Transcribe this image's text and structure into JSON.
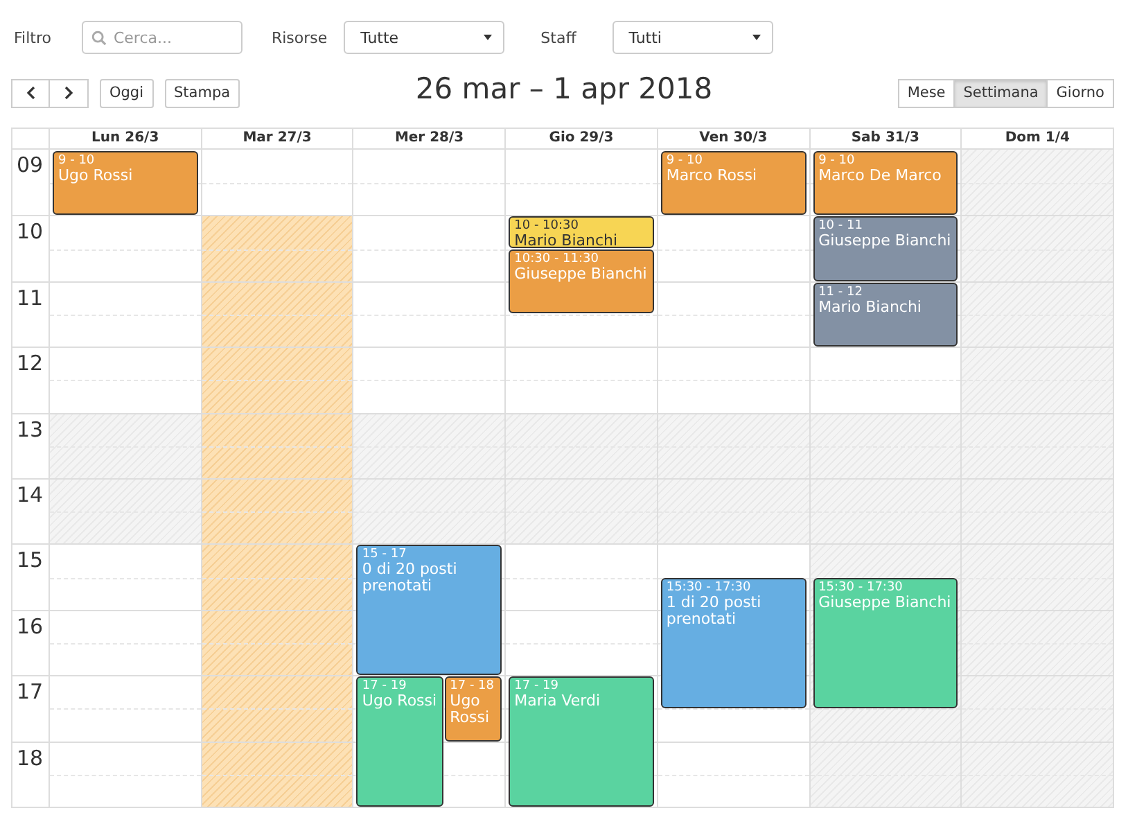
{
  "filters": {
    "filter_label": "Filtro",
    "search": {
      "placeholder": "Cerca..."
    },
    "resources_label": "Risorse",
    "resources": {
      "value": "Tutte"
    },
    "staff_label": "Staff",
    "staff": {
      "value": "Tutti"
    }
  },
  "toolbar": {
    "today": "Oggi",
    "print": "Stampa",
    "title": "26 mar – 1 apr 2018",
    "views": [
      {
        "label": "Mese",
        "selected": false
      },
      {
        "label": "Settimana",
        "selected": true
      },
      {
        "label": "Giorno",
        "selected": false
      }
    ]
  },
  "days": [
    {
      "label": "Lun 26/3",
      "events": [
        {
          "time": "9 - 10",
          "title": "Ugo Rossi",
          "color": "#eb9e45"
        }
      ]
    },
    {
      "label": "Mar 27/3"
    },
    {
      "label": "Mer 28/3",
      "events": [
        {
          "time": "15 - 17",
          "title": "0 di 20 posti prenotati",
          "color": "#66aee2"
        },
        {
          "time": "17 - 19",
          "title": "Ugo Rossi",
          "color": "#5ad3a0"
        },
        {
          "time": "17 - 18",
          "title": "Ugo Rossi",
          "color": "#eb9e45"
        }
      ]
    },
    {
      "label": "Gio 29/3",
      "events": [
        {
          "time": "10 - 10:30",
          "title": "Mario Bianchi",
          "color": "#f7d554"
        },
        {
          "time": "10:30 - 11:30",
          "title": "Giuseppe Bianchi",
          "color": "#eb9e45"
        },
        {
          "time": "17 - 19",
          "title": "Maria Verdi",
          "color": "#5ad3a0"
        }
      ]
    },
    {
      "label": "Ven 30/3",
      "events": [
        {
          "time": "9 - 10",
          "title": "Marco Rossi",
          "color": "#eb9e45"
        },
        {
          "time": "15:30 - 17:30",
          "title": "1 di 20 posti prenotati",
          "color": "#66aee2"
        }
      ]
    },
    {
      "label": "Sab 31/3",
      "events": [
        {
          "time": "9 - 10",
          "title": "Marco De Marco",
          "color": "#eb9e45"
        },
        {
          "time": "10 - 11",
          "title": "Giuseppe Bianchi",
          "color": "#8391a4"
        },
        {
          "time": "11 - 12",
          "title": "Mario Bianchi",
          "color": "#8391a4"
        },
        {
          "time": "15:30 - 17:30",
          "title": "Giuseppe Bianchi",
          "color": "#5ad3a0"
        }
      ]
    },
    {
      "label": "Dom 1/4"
    }
  ],
  "hours": [
    {
      "label": "09",
      "cells": [
        {
          "kind": "open"
        },
        {
          "kind": "open"
        },
        {
          "kind": "open"
        },
        {
          "kind": "open"
        },
        {
          "kind": "open"
        },
        {
          "kind": "open"
        },
        {
          "kind": "closed"
        }
      ]
    },
    {
      "label": "10",
      "cells": [
        {
          "kind": "open"
        },
        {
          "kind": "blocked"
        },
        {
          "kind": "open"
        },
        {
          "kind": "open"
        },
        {
          "kind": "open"
        },
        {
          "kind": "open"
        },
        {
          "kind": "closed"
        }
      ]
    },
    {
      "label": "11",
      "cells": [
        {
          "kind": "open"
        },
        {
          "kind": "blocked"
        },
        {
          "kind": "open"
        },
        {
          "kind": "open"
        },
        {
          "kind": "open"
        },
        {
          "kind": "open"
        },
        {
          "kind": "closed"
        }
      ]
    },
    {
      "label": "12",
      "cells": [
        {
          "kind": "open"
        },
        {
          "kind": "blocked"
        },
        {
          "kind": "open"
        },
        {
          "kind": "open"
        },
        {
          "kind": "open"
        },
        {
          "kind": "open"
        },
        {
          "kind": "closed"
        }
      ]
    },
    {
      "label": "13",
      "cells": [
        {
          "kind": "closed"
        },
        {
          "kind": "blocked"
        },
        {
          "kind": "closed"
        },
        {
          "kind": "closed"
        },
        {
          "kind": "closed"
        },
        {
          "kind": "closed"
        },
        {
          "kind": "closed"
        }
      ]
    },
    {
      "label": "14",
      "cells": [
        {
          "kind": "closed"
        },
        {
          "kind": "blocked"
        },
        {
          "kind": "closed"
        },
        {
          "kind": "closed"
        },
        {
          "kind": "closed"
        },
        {
          "kind": "closed"
        },
        {
          "kind": "closed"
        }
      ]
    },
    {
      "label": "15",
      "cells": [
        {
          "kind": "open"
        },
        {
          "kind": "blocked"
        },
        {
          "kind": "open"
        },
        {
          "kind": "open"
        },
        {
          "kind": "open"
        },
        {
          "kind": "closed"
        },
        {
          "kind": "closed"
        }
      ]
    },
    {
      "label": "16",
      "cells": [
        {
          "kind": "open"
        },
        {
          "kind": "blocked"
        },
        {
          "kind": "open"
        },
        {
          "kind": "open"
        },
        {
          "kind": "open"
        },
        {
          "kind": "closed"
        },
        {
          "kind": "closed"
        }
      ]
    },
    {
      "label": "17",
      "cells": [
        {
          "kind": "open"
        },
        {
          "kind": "blocked"
        },
        {
          "kind": "open"
        },
        {
          "kind": "open"
        },
        {
          "kind": "open"
        },
        {
          "kind": "closed"
        },
        {
          "kind": "closed"
        }
      ]
    },
    {
      "label": "18",
      "cells": [
        {
          "kind": "open"
        },
        {
          "kind": "blocked"
        },
        {
          "kind": "open"
        },
        {
          "kind": "open"
        },
        {
          "kind": "open"
        },
        {
          "kind": "closed"
        },
        {
          "kind": "closed"
        }
      ]
    }
  ]
}
